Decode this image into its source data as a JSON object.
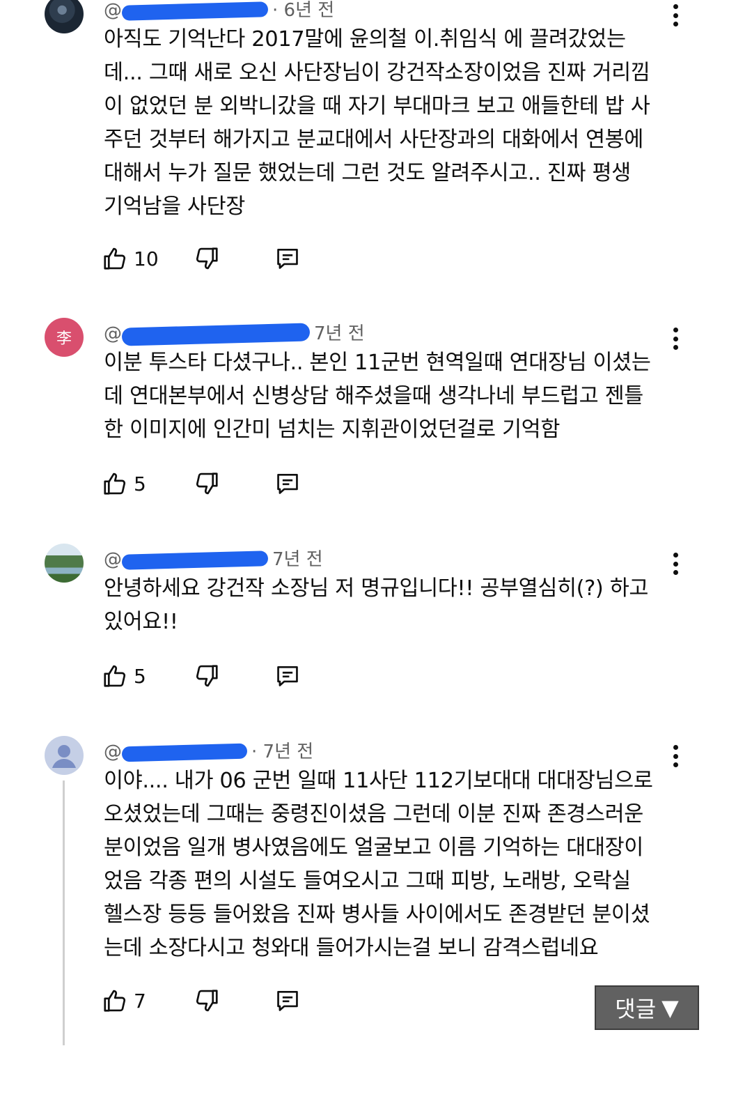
{
  "comments": [
    {
      "avatar": "photo-avatar",
      "handle_visible": "@",
      "age": "· 6년 전",
      "lines": [
        "아직도 기억난다 2017말에 윤의철 이.취임식 에 끌려갔었는",
        "데... 그때 새로 오신 사단장님이 강건작소장이었음 진짜 거리낌",
        "이 없었던 분 외박니갔을 때 자기 부대마크 보고 애들한테 밥 사",
        "주던 것부터 해가지고 분교대에서 사단장과의 대화에서 연봉에",
        "대해서 누가 질문 했었는데 그런 것도 알려주시고.. 진짜 평생",
        "기억남을 사단장"
      ],
      "likes": "10"
    },
    {
      "avatar": "李",
      "handle_visible": "@",
      "age": "7년 전",
      "lines": [
        "이분 투스타 다셨구나.. 본인 11군번 현역일때 연대장님 이셨는",
        "데 연대본부에서 신병상담 해주셨을때 생각나네 부드럽고 젠틀",
        "한 이미지에 인간미 넘치는 지휘관이었던걸로 기억함"
      ],
      "likes": "5"
    },
    {
      "avatar": "landscape-avatar",
      "handle_visible": "@",
      "age": "7년 전",
      "lines": [
        "안녕하세요 강건작 소장님 저 명규입니다!! 공부열심히(?) 하고",
        "있어요!!"
      ],
      "likes": "5"
    },
    {
      "avatar": "default-user-avatar",
      "handle_visible": "@",
      "age": "· 7년 전",
      "lines": [
        "이야.... 내가 06 군번 일때 11사단 112기보대대 대대장님으로",
        "오셨었는데 그때는 중령진이셨음 그런데 이분 진짜 존경스러운",
        "분이었음 일개 병사였음에도 얼굴보고 이름 기억하는 대대장이",
        "었음 각종 편의 시설도 들여오시고 그때 피방, 노래방, 오락실",
        "헬스장 등등 들어왔음 진짜 병사들 사이에서도 존경받던 분이셨",
        "는데 소장다시고 청와대 들어가시는걸 보니 감격스럽네요"
      ],
      "likes": "7"
    }
  ],
  "reply_toggle": {
    "label": "댓글",
    "arrow": "▼"
  },
  "icons": [
    "thumbs-up-icon",
    "thumbs-down-icon",
    "reply-icon",
    "more-vert-icon",
    "person-icon"
  ],
  "colors": {
    "redaction": "#1f63ef",
    "meta": "#606060",
    "toggle_bg": "#616161"
  }
}
